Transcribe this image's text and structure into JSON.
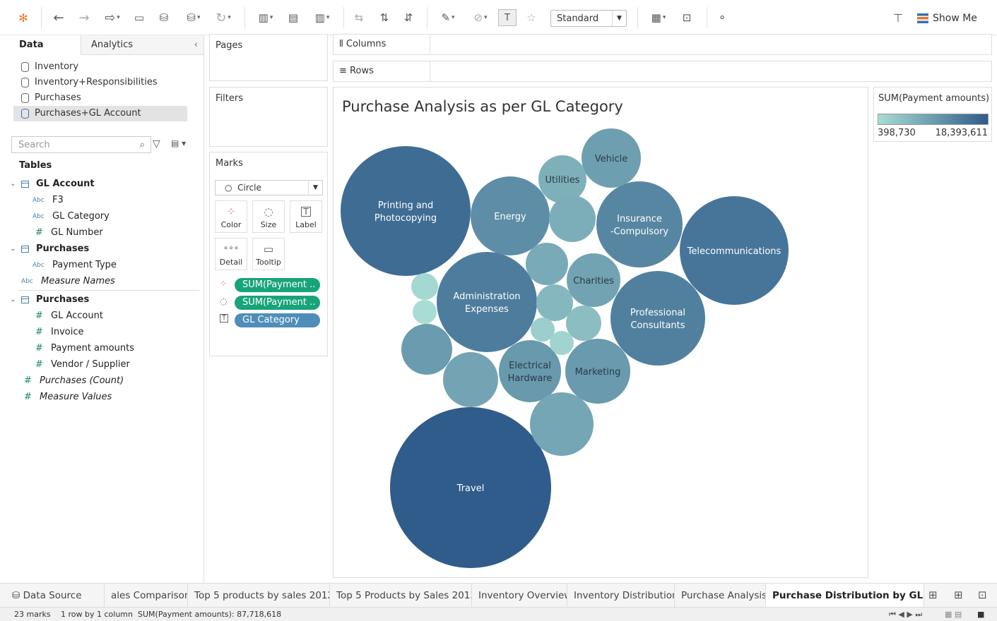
{
  "toolbar": {
    "view_size": "Standard",
    "show_me": "Show Me"
  },
  "left_pane": {
    "tabs": [
      "Data",
      "Analytics"
    ],
    "datasources": [
      "Inventory",
      "Inventory+Responsibilities",
      "Purchases",
      "Purchases+GL Account"
    ],
    "search_placeholder": "Search",
    "tables_heading": "Tables",
    "fields": [
      {
        "label": "GL Account",
        "kind": "table"
      },
      {
        "label": "F3",
        "kind": "abc"
      },
      {
        "label": "GL Category",
        "kind": "abc"
      },
      {
        "label": "GL Number",
        "kind": "hash"
      },
      {
        "label": "Purchases",
        "kind": "table"
      },
      {
        "label": "Payment Type",
        "kind": "abc"
      },
      {
        "label": "Measure Names",
        "kind": "abc-italic"
      },
      {
        "label": "Purchases",
        "kind": "table"
      },
      {
        "label": "GL Account",
        "kind": "hash"
      },
      {
        "label": "Invoice",
        "kind": "hash"
      },
      {
        "label": "Payment amounts",
        "kind": "hash"
      },
      {
        "label": "Vendor / Supplier",
        "kind": "hash"
      },
      {
        "label": "Purchases (Count)",
        "kind": "hash-italic"
      },
      {
        "label": "Measure Values",
        "kind": "hash-italic"
      }
    ],
    "abc_tag": "Abc",
    "hash_tag": "#"
  },
  "cards": {
    "pages": "Pages",
    "filters": "Filters",
    "marks": "Marks",
    "mark_type": "Circle",
    "mark_buttons": [
      "Color",
      "Size",
      "Label",
      "Detail",
      "Tooltip"
    ],
    "pills": [
      "SUM(Payment ..",
      "SUM(Payment ..",
      "GL Category"
    ]
  },
  "shelves": {
    "columns": "Columns",
    "rows": "Rows"
  },
  "viz": {
    "title": "Purchase Analysis as per GL Category"
  },
  "legend": {
    "title": "SUM(Payment amounts)",
    "min": "398,730",
    "max": "18,393,611"
  },
  "sheet_tabs": [
    "Data Source",
    "ales Comparison",
    "Top 5 products by sales 2012",
    "Top 5 Products by Sales 2013",
    "Inventory Overview",
    "Inventory Distribution",
    "Purchase Analysis",
    "Purchase Distribution by GL Ca..."
  ],
  "status": {
    "marks": "23 marks",
    "rows_cols": "1 row by 1 column",
    "sum": "SUM(Payment amounts): 87,718,618"
  },
  "chart_data": {
    "type": "packed-bubble",
    "title": "Purchase Analysis as per GL Category",
    "color_scale": {
      "min": 398730,
      "max": 18393611,
      "from": "#a8dcd4",
      "to": "#2f5c8a"
    },
    "bubbles": [
      {
        "label": "Travel",
        "value": 18393611
      },
      {
        "label": "Printing and\nPhotocopying",
        "value": 11500000
      },
      {
        "label": "Telecommunications",
        "value": 8600000
      },
      {
        "label": "Administration\nExpenses",
        "value": 7000000
      },
      {
        "label": "Professional\nConsultants",
        "value": 6200000
      },
      {
        "label": "Insurance\n-Compulsory",
        "value": 5200000
      },
      {
        "label": "Energy",
        "value": 4200000
      },
      {
        "label": "Marketing",
        "value": 2900000
      },
      {
        "label": "Electrical\nHardware",
        "value": 3000000
      },
      {
        "label": "Charities",
        "value": 2200000
      },
      {
        "label": "Vehicle",
        "value": 2500000
      },
      {
        "label": "Utilities",
        "value": 1500000
      },
      {
        "label": "",
        "value": 2800000
      },
      {
        "label": "",
        "value": 2100000
      },
      {
        "label": "",
        "value": 2000000
      },
      {
        "label": "",
        "value": 1600000
      },
      {
        "label": "",
        "value": 1800000
      },
      {
        "label": "",
        "value": 1200000
      },
      {
        "label": "",
        "value": 1000000
      },
      {
        "label": "",
        "value": 600000
      },
      {
        "label": "",
        "value": 500000
      },
      {
        "label": "",
        "value": 450000
      },
      {
        "label": "",
        "value": 398730
      }
    ]
  }
}
